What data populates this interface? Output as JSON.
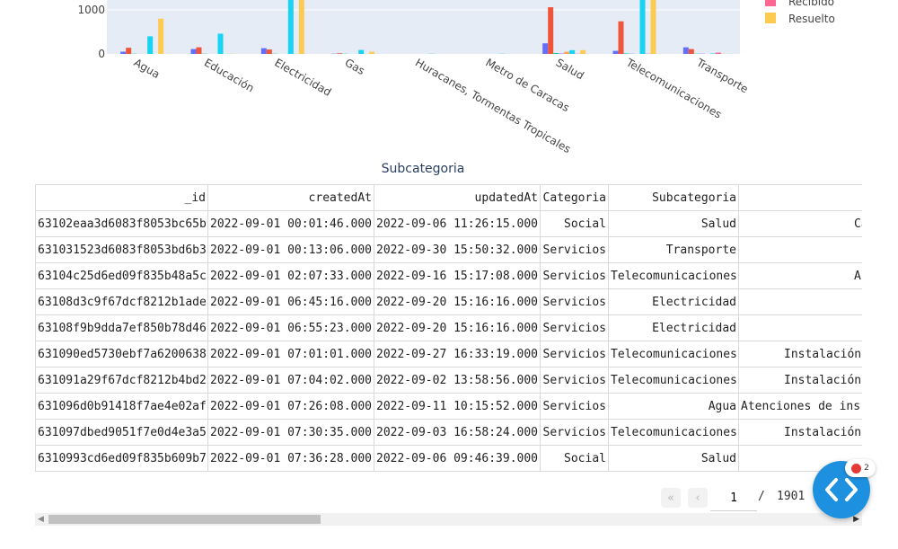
{
  "chart_data": {
    "type": "bar",
    "title": "",
    "xlabel": "Subcategoria",
    "ylabel": "",
    "ylim": [
      0,
      1200
    ],
    "yticks": [
      "0",
      "1000"
    ],
    "categories": [
      "Agua",
      "Educación",
      "Electricidad",
      "Gas",
      "Huracanes, Tormentas Tropicales",
      "Metro de Caracas",
      "Salud",
      "Telecomunicaciones",
      "Transporte"
    ],
    "legend_position": "top-right",
    "series": [
      {
        "name": "",
        "color": "#636efa",
        "values": [
          50,
          110,
          130,
          5,
          0,
          0,
          240,
          70,
          150
        ]
      },
      {
        "name": "",
        "color": "#ef553b",
        "values": [
          140,
          150,
          100,
          15,
          0,
          0,
          1060,
          740,
          110
        ]
      },
      {
        "name": "",
        "color": "#00cc96",
        "values": [
          5,
          5,
          5,
          5,
          0,
          0,
          20,
          10,
          5
        ]
      },
      {
        "name": "",
        "color": "#ab63fa",
        "values": [
          0,
          0,
          0,
          0,
          0,
          0,
          10,
          5,
          5
        ]
      },
      {
        "name": "",
        "color": "#ffa15a",
        "values": [
          0,
          0,
          0,
          0,
          0,
          0,
          50,
          0,
          0
        ]
      },
      {
        "name": "",
        "color": "#19d3f3",
        "values": [
          400,
          460,
          1250,
          90,
          5,
          5,
          85,
          1250,
          10
        ]
      },
      {
        "name": "Recibido",
        "color": "#ff6692",
        "values": [
          0,
          0,
          0,
          0,
          0,
          0,
          5,
          5,
          30
        ]
      },
      {
        "name": "Resuelto",
        "color": "#fecb52",
        "values": [
          800,
          5,
          1250,
          50,
          0,
          0,
          85,
          1250,
          5
        ]
      }
    ]
  },
  "legend": [
    {
      "label": "Recibido",
      "color": "#ff6692"
    },
    {
      "label": "Resuelto",
      "color": "#fecb52"
    }
  ],
  "table": {
    "columns": [
      "_id",
      "createdAt",
      "updatedAt",
      "Categoria",
      "Subcategoria",
      ""
    ],
    "rows": [
      [
        "63102eaa3d6083f8053bc65b",
        "2022-09-01 00:01:46.000",
        "2022-09-06 11:26:15.000",
        "Social",
        "Salud",
        "Ca"
      ],
      [
        "631031523d6083f8053bd6b3",
        "2022-09-01 00:13:06.000",
        "2022-09-30 15:50:32.000",
        "Servicios",
        "Transporte",
        ""
      ],
      [
        "63104c25d6ed09f835b48a5c",
        "2022-09-01 02:07:33.000",
        "2022-09-16 15:17:08.000",
        "Servicios",
        "Telecomunicaciones",
        "A"
      ],
      [
        "63108d3c9f67dcf8212b1ade",
        "2022-09-01 06:45:16.000",
        "2022-09-20 15:16:16.000",
        "Servicios",
        "Electricidad",
        ""
      ],
      [
        "63108f9b9dda7ef850b78d46",
        "2022-09-01 06:55:23.000",
        "2022-09-20 15:16:16.000",
        "Servicios",
        "Electricidad",
        ""
      ],
      [
        "631090ed5730ebf7a6200638",
        "2022-09-01 07:01:01.000",
        "2022-09-27 16:33:19.000",
        "Servicios",
        "Telecomunicaciones",
        "Instalación"
      ],
      [
        "631091a29f67dcf8212b4bd2",
        "2022-09-01 07:04:02.000",
        "2022-09-02 13:58:56.000",
        "Servicios",
        "Telecomunicaciones",
        "Instalación"
      ],
      [
        "631096d0b91418f7ae4e02af",
        "2022-09-01 07:26:08.000",
        "2022-09-11 10:15:52.000",
        "Servicios",
        "Agua",
        "Atenciones de ins"
      ],
      [
        "631097dbed9051f7e0d4e3a5",
        "2022-09-01 07:30:35.000",
        "2022-09-03 16:58:24.000",
        "Servicios",
        "Telecomunicaciones",
        "Instalación"
      ],
      [
        "6310993cd6ed09f835b609b7",
        "2022-09-01 07:36:28.000",
        "2022-09-06 09:46:39.000",
        "Social",
        "Salud",
        ""
      ]
    ]
  },
  "pagination": {
    "current_page": "1",
    "separator": "/",
    "total_pages": "1901",
    "first_icon": "double-chevron-left-icon",
    "prev_icon": "chevron-left-icon"
  },
  "fab": {
    "icon": "code-brackets-icon",
    "badge_count": "2",
    "badge_color": "#e53935",
    "color": "#1e90e0"
  }
}
